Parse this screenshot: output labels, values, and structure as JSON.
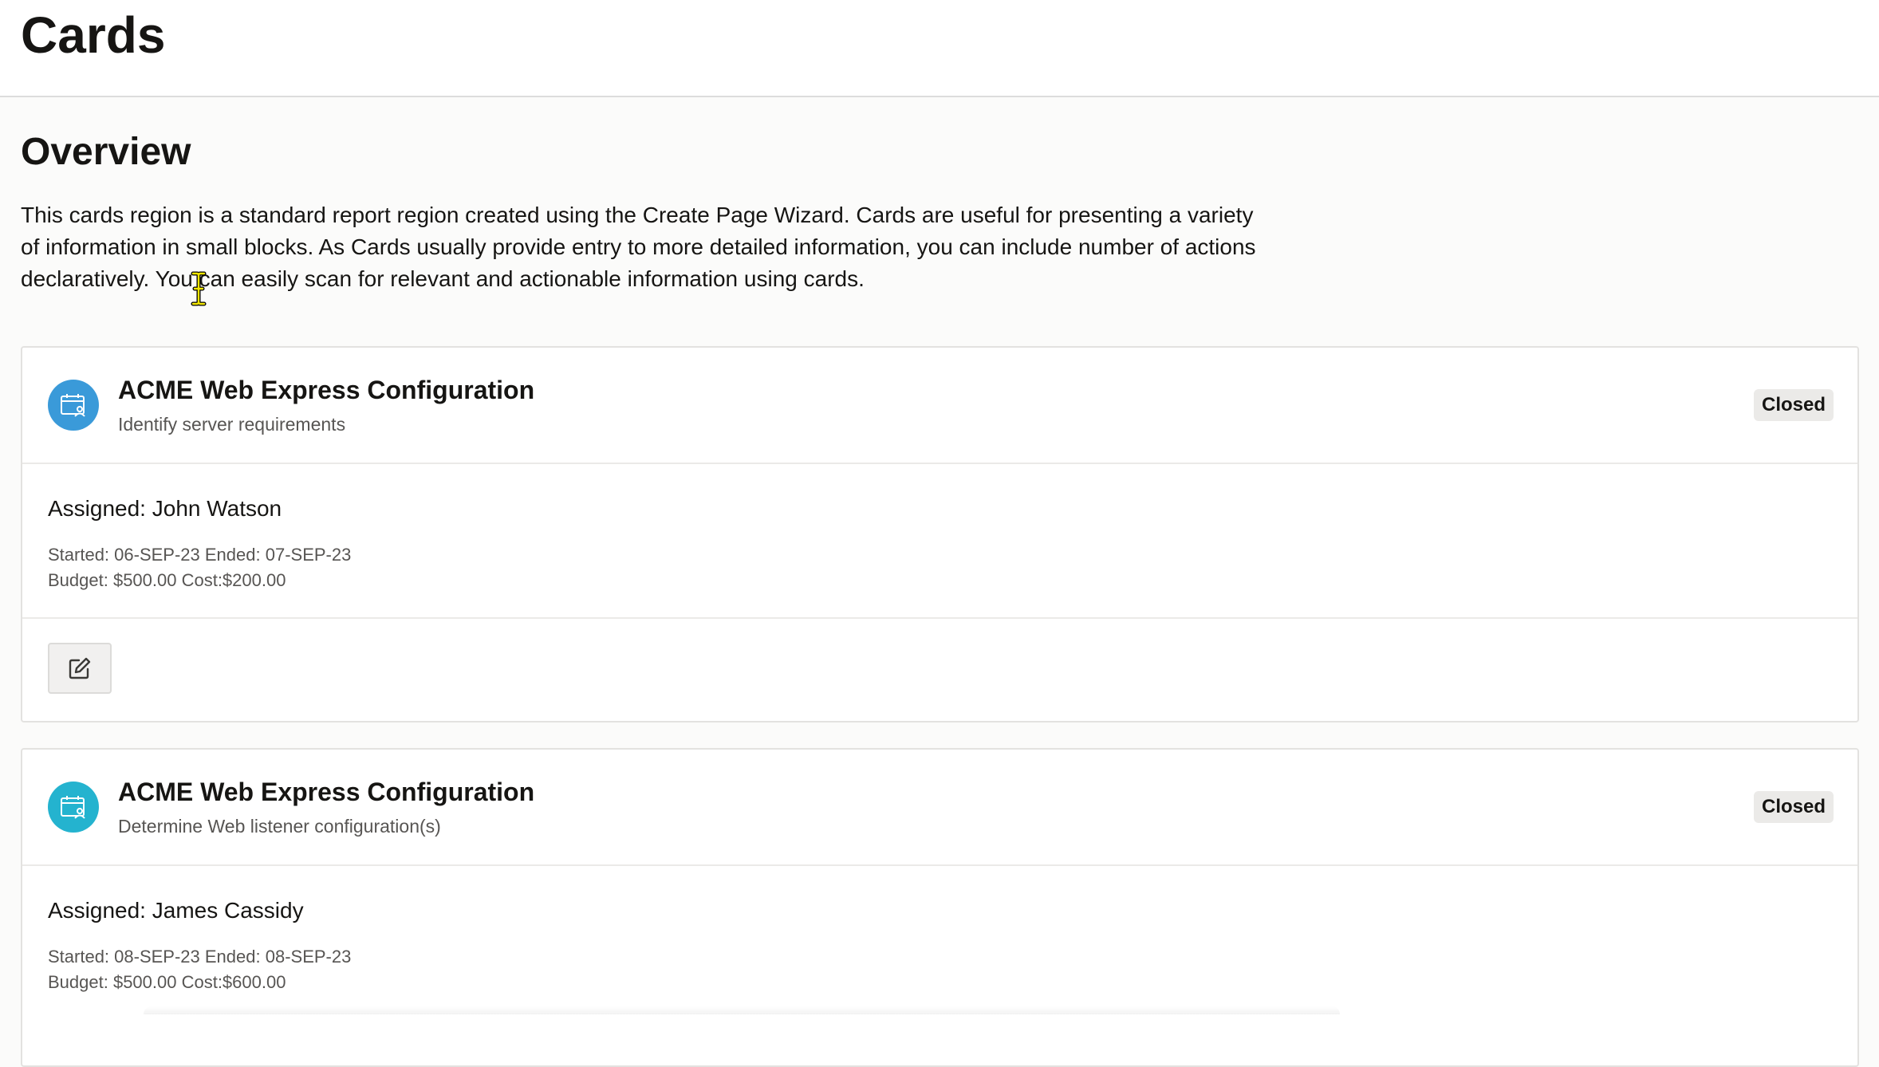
{
  "page": {
    "title": "Cards"
  },
  "overview": {
    "heading": "Overview",
    "description": "This cards region is a standard report region created using the Create Page Wizard. Cards are useful for presenting a variety of information in small blocks. As Cards usually provide entry to more detailed information, you can include number of actions declaratively. You can easily scan for relevant and actionable information using cards."
  },
  "cards": [
    {
      "title": "ACME Web Express Configuration",
      "subtitle": "Identify server requirements",
      "status": "Closed",
      "assigned": "Assigned: John Watson",
      "dates": "Started: 06-SEP-23 Ended: 07-SEP-23",
      "budget": "Budget: $500.00 Cost:$200.00",
      "icon": "calendar-user-icon",
      "icon_color": "#3a9ad9"
    },
    {
      "title": "ACME Web Express Configuration",
      "subtitle": "Determine Web listener configuration(s)",
      "status": "Closed",
      "assigned": "Assigned: James Cassidy",
      "dates": "Started: 08-SEP-23 Ended: 08-SEP-23",
      "budget": "Budget: $500.00 Cost:$600.00",
      "icon": "calendar-user-icon",
      "icon_color": "#24b3cf"
    }
  ],
  "actions": {
    "edit_icon": "edit-icon"
  }
}
